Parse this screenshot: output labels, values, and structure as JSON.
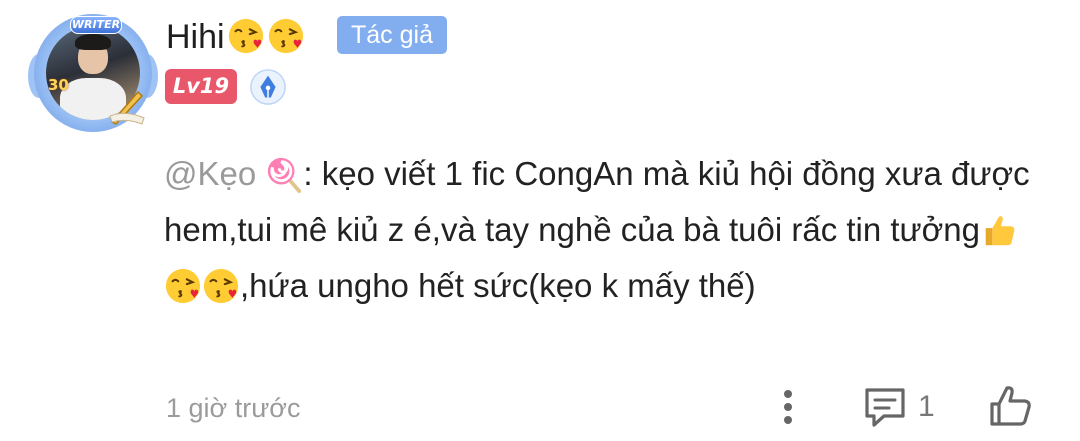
{
  "comment": {
    "author": {
      "name": "Hihi",
      "name_emojis": [
        "kiss-heart-emoji",
        "kiss-heart-emoji"
      ],
      "role_badge": "Tác giả",
      "level": "Lv19",
      "avatar_frame_label": "WRITER",
      "avatar_frame_number": "30",
      "badge_icon": "pen-nib-icon"
    },
    "body": {
      "mention": "@Kẹo",
      "mention_emoji": "lollipop-emoji",
      "text_part1": ": kẹo viết 1 fic CongAn mà kiủ hội đồng xưa được hem,tui mê kiủ z é,và tay nghề của bà tuôi rấc tin tưởng",
      "inline_emojis": [
        "thumbs-up-emoji",
        "kiss-heart-emoji",
        "kiss-heart-emoji"
      ],
      "text_part2": ",hứa ungho hết sức(kẹo k mấy thế)"
    },
    "footer": {
      "timestamp": "1 giờ trước",
      "reply_count": "1",
      "more_icon": "more-vertical-icon",
      "reply_icon": "comment-icon",
      "like_icon": "thumbs-up-outline-icon"
    }
  },
  "colors": {
    "role_badge_bg": "#82aef0",
    "level_badge_bg": "#e8586a",
    "mention_text": "#9a9a9a",
    "timestamp_text": "#9b9b9b",
    "body_text": "#222222"
  }
}
